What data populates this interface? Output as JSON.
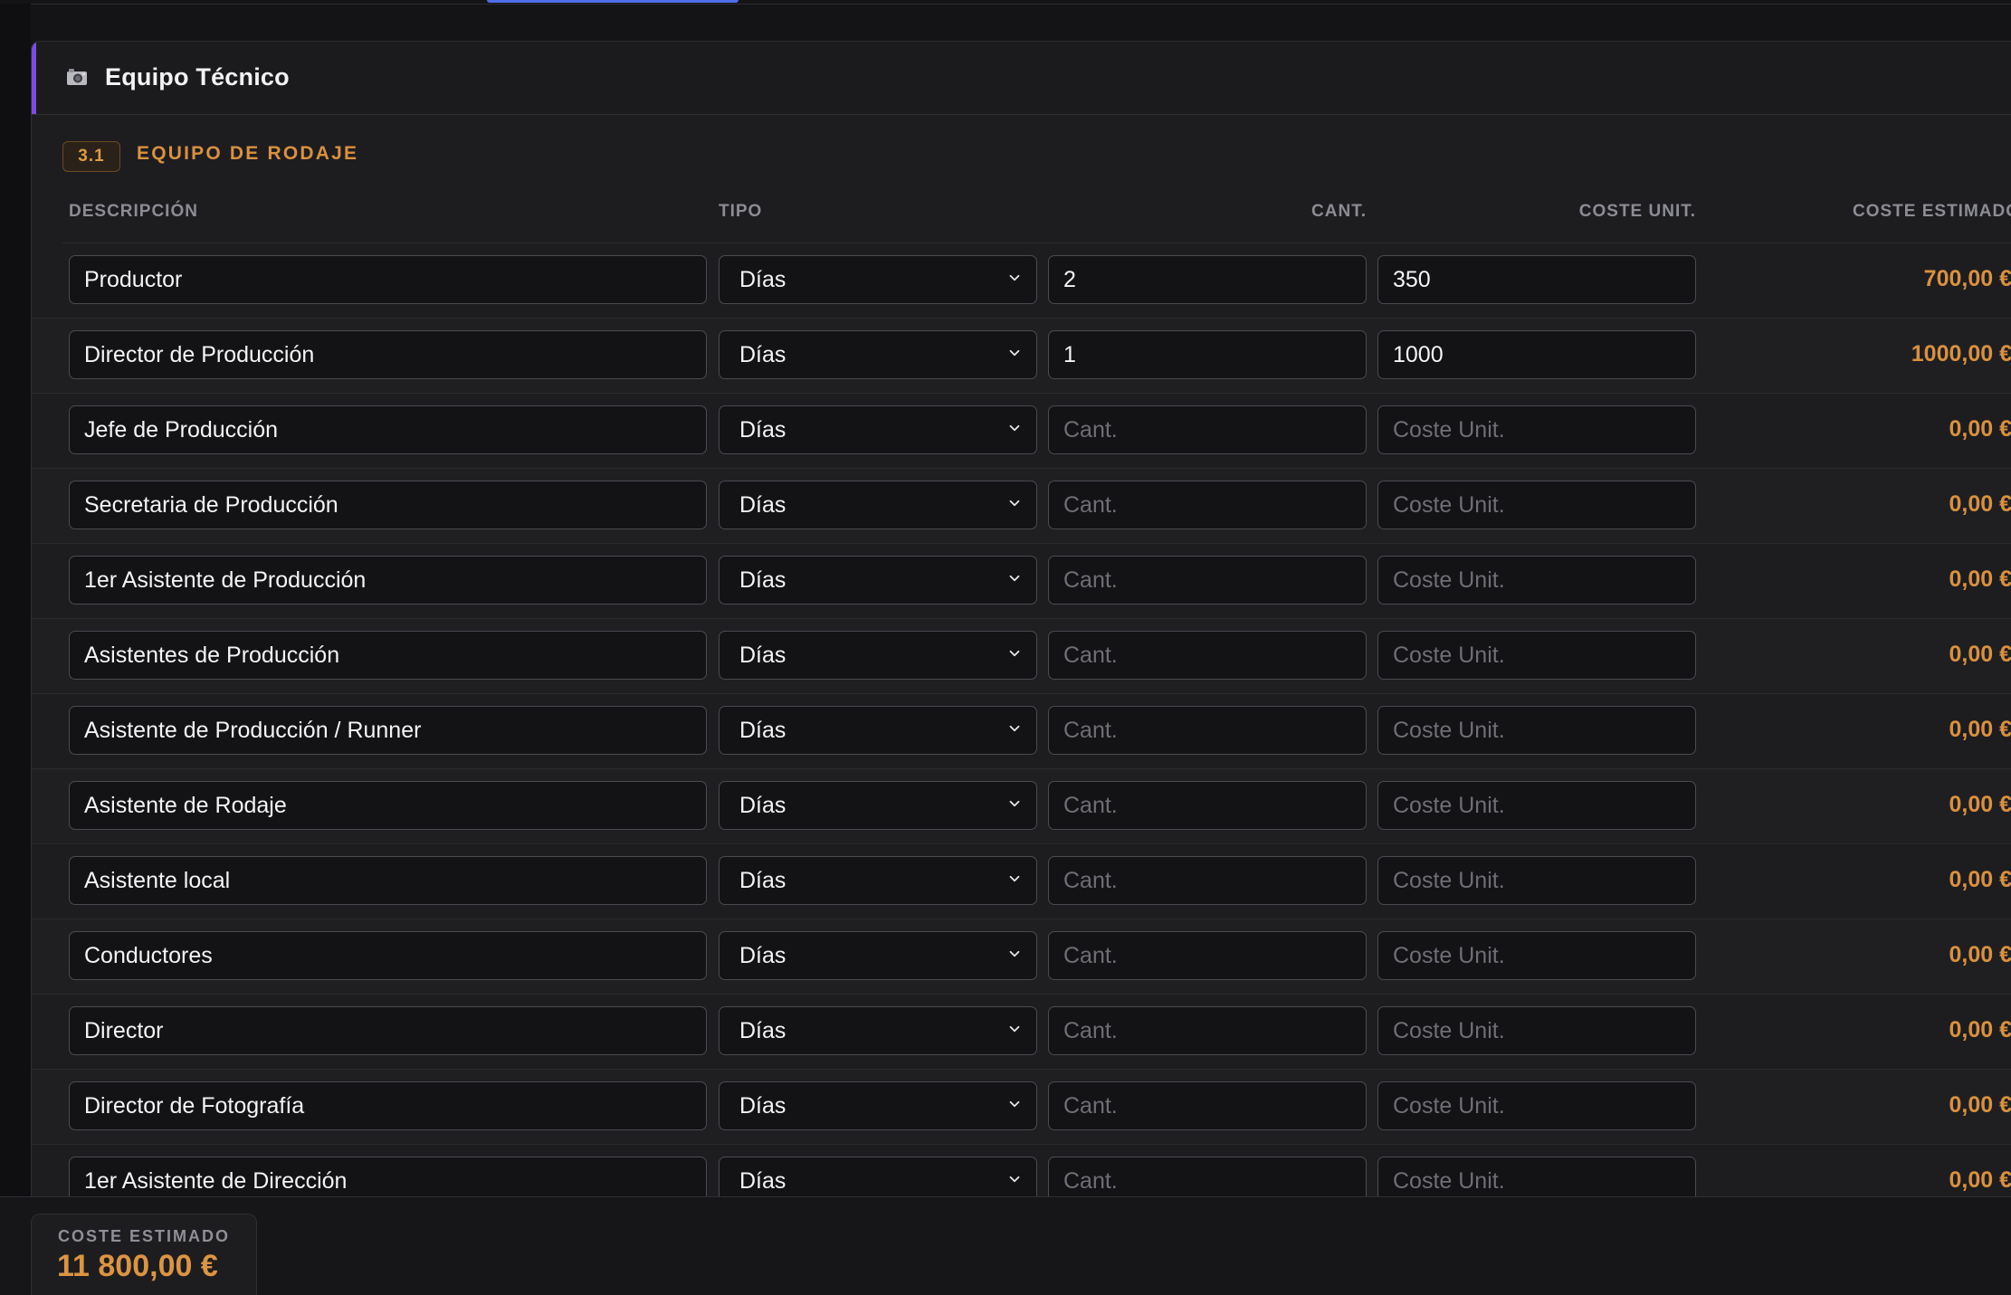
{
  "panel": {
    "icon": "camera-icon",
    "title": "Equipo Técnico"
  },
  "section": {
    "number": "3.1",
    "title": "EQUIPO DE RODAJE"
  },
  "columns": {
    "description": "DESCRIPCIÓN",
    "type": "TIPO",
    "quantity": "CANT.",
    "unit_cost": "COSTE UNIT.",
    "estimated_cost": "COSTE ESTIMADO"
  },
  "placeholders": {
    "quantity": "Cant.",
    "unit_cost": "Coste Unit."
  },
  "rows": [
    {
      "description": "Productor",
      "type": "Días",
      "quantity": "2",
      "unit_cost": "350",
      "total": "700,00 €"
    },
    {
      "description": "Director de Producción",
      "type": "Días",
      "quantity": "1",
      "unit_cost": "1000",
      "total": "1000,00 €"
    },
    {
      "description": "Jefe de Producción",
      "type": "Días",
      "quantity": "",
      "unit_cost": "",
      "total": "0,00 €"
    },
    {
      "description": "Secretaria de Producción",
      "type": "Días",
      "quantity": "",
      "unit_cost": "",
      "total": "0,00 €"
    },
    {
      "description": "1er Asistente de Producción",
      "type": "Días",
      "quantity": "",
      "unit_cost": "",
      "total": "0,00 €"
    },
    {
      "description": "Asistentes de Producción",
      "type": "Días",
      "quantity": "",
      "unit_cost": "",
      "total": "0,00 €"
    },
    {
      "description": "Asistente de Producción / Runner",
      "type": "Días",
      "quantity": "",
      "unit_cost": "",
      "total": "0,00 €"
    },
    {
      "description": "Asistente de Rodaje",
      "type": "Días",
      "quantity": "",
      "unit_cost": "",
      "total": "0,00 €"
    },
    {
      "description": "Asistente local",
      "type": "Días",
      "quantity": "",
      "unit_cost": "",
      "total": "0,00 €"
    },
    {
      "description": "Conductores",
      "type": "Días",
      "quantity": "",
      "unit_cost": "",
      "total": "0,00 €"
    },
    {
      "description": "Director",
      "type": "Días",
      "quantity": "",
      "unit_cost": "",
      "total": "0,00 €"
    },
    {
      "description": "Director de Fotografía",
      "type": "Días",
      "quantity": "",
      "unit_cost": "",
      "total": "0,00 €"
    },
    {
      "description": "1er Asistente de Dirección",
      "type": "Días",
      "quantity": "",
      "unit_cost": "",
      "total": "0,00 €"
    }
  ],
  "footer": {
    "label": "COSTE ESTIMADO",
    "value": "11 800,00 €"
  },
  "colors": {
    "accent": "#7a4de0",
    "amount": "#d9913e",
    "tab_indicator": "#4f6ee8"
  }
}
